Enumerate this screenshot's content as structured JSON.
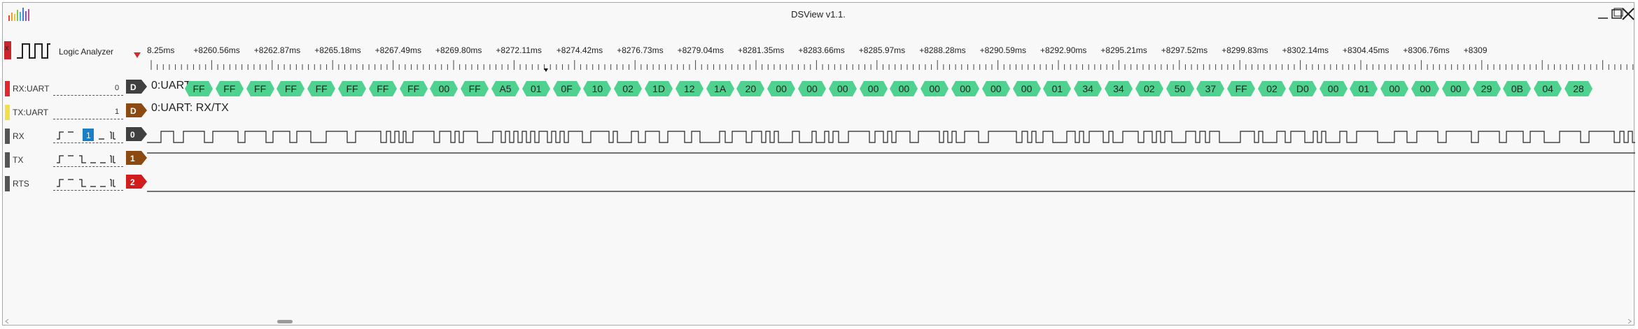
{
  "window": {
    "title": "DSView v1.1."
  },
  "header": {
    "analyzer_label": "Logic Analyzer",
    "analyzer_icon_text": "x",
    "ruler_labels": [
      "8.25ms",
      "+8260.56ms",
      "+8262.87ms",
      "+8265.18ms",
      "+8267.49ms",
      "+8269.80ms",
      "+8272.11ms",
      "+8274.42ms",
      "+8276.73ms",
      "+8279.04ms",
      "+8281.35ms",
      "+8283.66ms",
      "+8285.97ms",
      "+8288.28ms",
      "+8290.59ms",
      "+8292.90ms",
      "+8295.21ms",
      "+8297.52ms",
      "+8299.83ms",
      "+8302.14ms",
      "+8304.45ms",
      "+8306.76ms",
      "+8309"
    ]
  },
  "rows": {
    "rx_uart": {
      "name": "RX:UART",
      "index": "0",
      "tag": "D",
      "decode_label": "0:UART: ",
      "color": "#e0282e",
      "tag_color": "#404040"
    },
    "tx_uart": {
      "name": "TX:UART",
      "index": "1",
      "tag": "D",
      "decode_label": "0:UART: RX/TX",
      "color": "#f1e04a",
      "tag_color": "#8b4a12"
    },
    "rx": {
      "name": "RX",
      "tag": "0",
      "trigger_value": "1",
      "color": "#555555",
      "tag_color": "#404040"
    },
    "tx": {
      "name": "TX",
      "tag": "1",
      "color": "#555555",
      "tag_color": "#8b4a12"
    },
    "rts": {
      "name": "RTS",
      "tag": "2",
      "color": "#555555",
      "tag_color": "#d11d1d"
    }
  },
  "decoded_bytes": [
    "FF",
    "FF",
    "FF",
    "FF",
    "FF",
    "FF",
    "FF",
    "FF",
    "00",
    "FF",
    "A5",
    "01",
    "0F",
    "10",
    "02",
    "1D",
    "12",
    "1A",
    "20",
    "00",
    "00",
    "00",
    "00",
    "00",
    "00",
    "00",
    "00",
    "00",
    "01",
    "34",
    "34",
    "02",
    "50",
    "37",
    "FF",
    "02",
    "D0",
    "00",
    "01",
    "00",
    "00",
    "00",
    "29",
    "0B",
    "04",
    "28"
  ],
  "colors": {
    "decode_cell": "#4fd18f",
    "trigger_highlight": "#1a7fc4",
    "window_bg": "#f8f8f8"
  }
}
